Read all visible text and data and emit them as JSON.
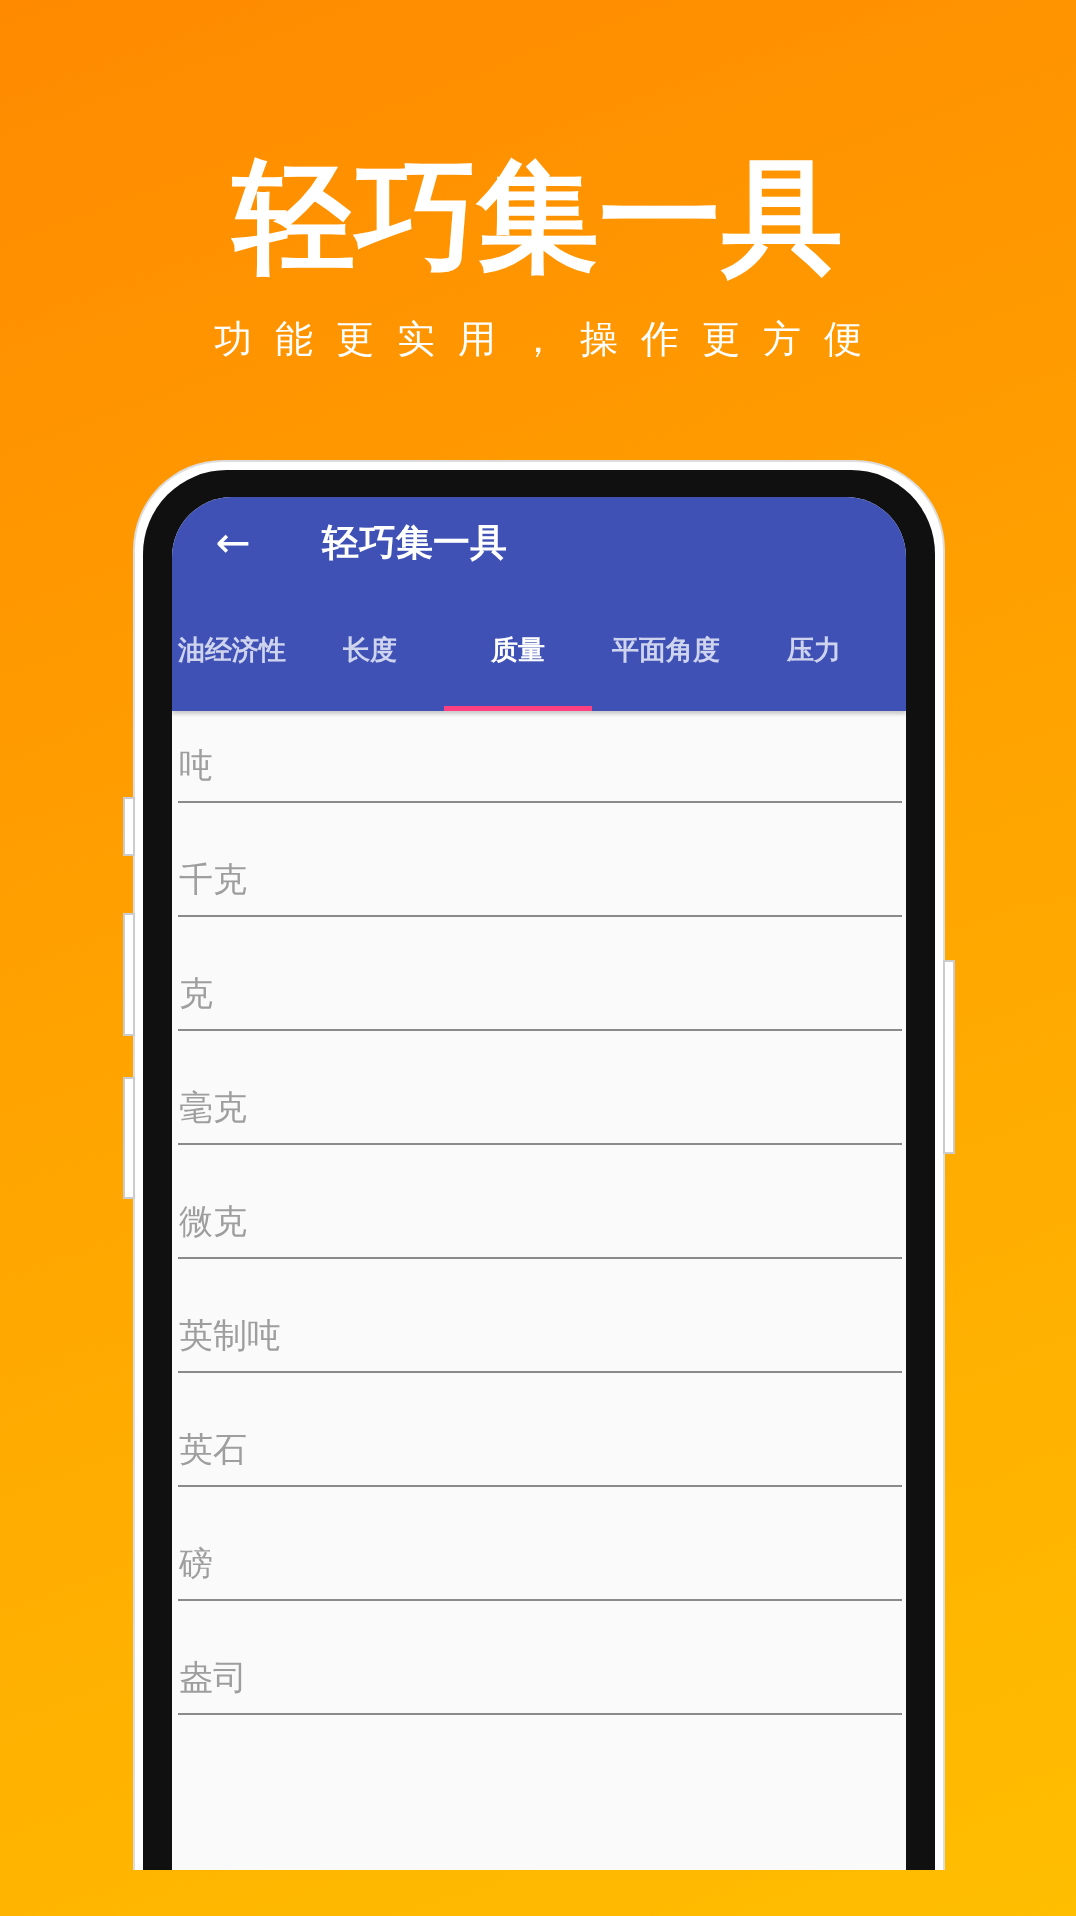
{
  "headline": "轻巧集一具",
  "subtitle": "功能更实用，操作更方便",
  "app_bar": {
    "back": "←",
    "title": "轻巧集一具"
  },
  "tabs": [
    {
      "label": "油经济性",
      "selected": false
    },
    {
      "label": "长度",
      "selected": false
    },
    {
      "label": "质量",
      "selected": true
    },
    {
      "label": "平面角度",
      "selected": false
    },
    {
      "label": "压力",
      "selected": false
    }
  ],
  "fields": [
    {
      "placeholder": "吨"
    },
    {
      "placeholder": "千克"
    },
    {
      "placeholder": "克"
    },
    {
      "placeholder": "毫克"
    },
    {
      "placeholder": "微克"
    },
    {
      "placeholder": "英制吨"
    },
    {
      "placeholder": "英石"
    },
    {
      "placeholder": "磅"
    },
    {
      "placeholder": "盎司"
    }
  ]
}
